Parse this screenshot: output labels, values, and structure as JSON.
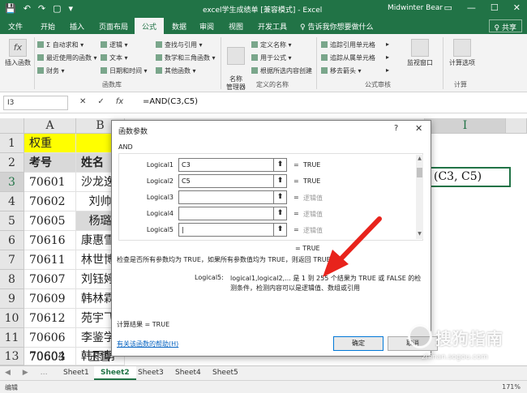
{
  "window": {
    "title": "excel学生成绩单 [兼容模式] - Excel",
    "user": "Midwinter Bear",
    "controls": [
      "▭",
      "—",
      "☐",
      "✕"
    ]
  },
  "quick_access": [
    "💾",
    "↶",
    "↷",
    "▢",
    "▾"
  ],
  "ribbon_tabs": [
    "文件",
    "开始",
    "插入",
    "页面布局",
    "公式",
    "数据",
    "审阅",
    "视图",
    "开发工具"
  ],
  "ribbon_active_tab": "公式",
  "tell_me": "♀ 告诉我你想要做什么",
  "share": "♀ 共享",
  "ribbon": {
    "insert_function": {
      "icon": "fx",
      "label": "插入函数"
    },
    "lib_col1": [
      "Σ 自动求和 ▾",
      "最近使用的函数 ▾",
      "财务 ▾"
    ],
    "lib_col2": [
      "逻辑 ▾",
      "文本 ▾",
      "日期和时间 ▾"
    ],
    "lib_col3": [
      "查找与引用 ▾",
      "数学和三角函数 ▾",
      "其他函数 ▾"
    ],
    "library_group": "函数库",
    "name_manager": {
      "label": "名称\n管理器"
    },
    "names_col": [
      "定义名称 ▾",
      "用于公式 ▾",
      "根据所选内容创建"
    ],
    "names_group": "定义的名称",
    "audit_col1": [
      "追踪引用单元格",
      "追踪从属单元格",
      "移去箭头 ▾"
    ],
    "audit_col2": [
      "▸",
      "▸",
      "▸"
    ],
    "watch_window": {
      "label": "监视窗口"
    },
    "audit_group": "公式审核",
    "calc_options": {
      "label": "计算选项"
    },
    "calc_group": "计算"
  },
  "formula_bar": {
    "name_box": "I3",
    "cancel": "✕",
    "enter": "✓",
    "fx": "fx",
    "formula": "=AND(C3,C5)"
  },
  "columns": [
    "A",
    "B",
    "I"
  ],
  "rows": [
    "1",
    "2",
    "3",
    "4",
    "5",
    "6",
    "7",
    "8",
    "9",
    "10",
    "11",
    "12",
    "13"
  ],
  "cells": {
    "a1": "权重",
    "a2": "考号",
    "b2": "姓名",
    "a": [
      "70601",
      "70602",
      "70605",
      "70616",
      "70611",
      "70607",
      "70609",
      "70612",
      "70606",
      "70603",
      "70604"
    ],
    "b": [
      "沙龙逸",
      "刘帅",
      "杨璐",
      "康惠雪",
      "林世博",
      "刘钰婷",
      "韩林霖",
      "苑宇飞",
      "李鉴学",
      "王雪",
      "韩雨萌"
    ],
    "i3": "(C3, C5)"
  },
  "dialog": {
    "title": "函数参数",
    "help": "?",
    "close": "✕",
    "function_name": "AND",
    "args": [
      {
        "label": "Logical1",
        "value": "C3",
        "result": "TRUE"
      },
      {
        "label": "Logical2",
        "value": "C5",
        "result": "TRUE"
      },
      {
        "label": "Logical3",
        "value": "",
        "result": "逻辑值"
      },
      {
        "label": "Logical4",
        "value": "",
        "result": "逻辑值"
      },
      {
        "label": "Logical5",
        "value": "|",
        "result": "逻辑值"
      }
    ],
    "ref_button": "⬆",
    "equals": "=",
    "final_result": "= TRUE",
    "description": "检查是否所有参数均为 TRUE，如果所有参数值均为 TRUE，则返回 TRUE",
    "arg_name": "Logical5:",
    "arg_description": "logical1,logical2,... 是 1 到 255 个结果为 TRUE 或 FALSE 的检测条件，检测内容可以是逻辑值、数组或引用",
    "calc_result": "计算结果 = TRUE",
    "help_link": "有关该函数的帮助(H)",
    "ok": "确定",
    "cancel": "取消"
  },
  "sheet_tabs": [
    "Sheet1",
    "Sheet2",
    "Sheet3",
    "Sheet4",
    "Sheet5"
  ],
  "active_sheet": "Sheet2",
  "nav_arrows": "◀ ▶ …",
  "status": {
    "mode": "编辑",
    "zoom": "171%"
  },
  "watermark": {
    "text": "搜狗指南",
    "url": "zhinan.sogou.com"
  },
  "colors": {
    "excel_green": "#217346",
    "arrow_red": "#e8231c",
    "yellow": "#ffff00"
  }
}
